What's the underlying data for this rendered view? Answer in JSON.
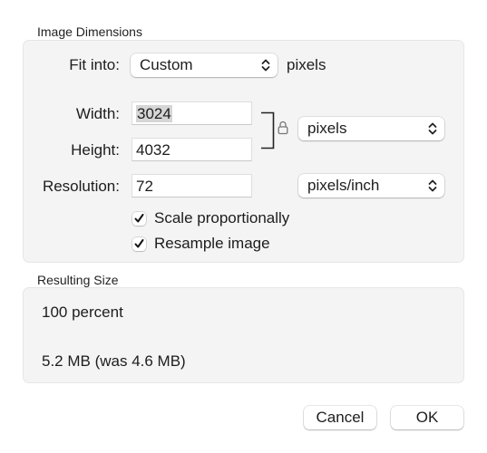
{
  "image_dimensions": {
    "section_title": "Image Dimensions",
    "fit_into": {
      "label": "Fit into:",
      "value": "Custom",
      "unit_label": "pixels"
    },
    "width": {
      "label": "Width:",
      "value": "3024",
      "selected": true
    },
    "height": {
      "label": "Height:",
      "value": "4032"
    },
    "size_unit": {
      "value": "pixels",
      "lock_icon": "lock-icon"
    },
    "resolution": {
      "label": "Resolution:",
      "value": "72",
      "unit": "pixels/inch"
    },
    "scale_proportionally": {
      "label": "Scale proportionally",
      "checked": true
    },
    "resample_image": {
      "label": "Resample image",
      "checked": true
    }
  },
  "resulting_size": {
    "section_title": "Resulting Size",
    "percent_text": "100 percent",
    "size_text": "5.2 MB (was 4.6 MB)"
  },
  "buttons": {
    "cancel": "Cancel",
    "ok": "OK"
  }
}
